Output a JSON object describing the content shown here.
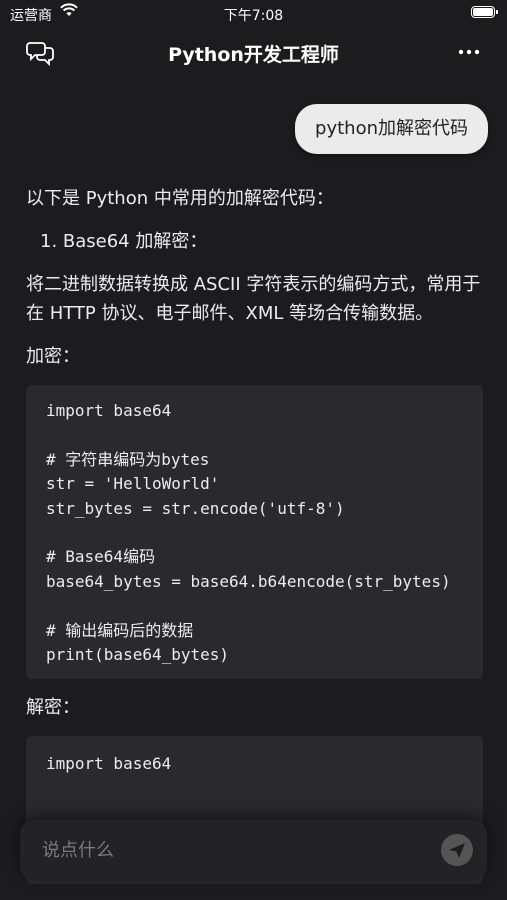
{
  "status_bar": {
    "carrier": "运营商",
    "time": "下午7:08"
  },
  "nav": {
    "title": "Python开发工程师"
  },
  "user_message": "python加解密代码",
  "answer": {
    "intro": "以下是 Python 中常用的加解密代码：",
    "item1": "1.  Base64 加解密：",
    "desc": "将二进制数据转换成 ASCII 字符表示的编码方式，常用于在 HTTP 协议、电子邮件、XML 等场合传输数据。",
    "encrypt_label": "加密：",
    "encrypt_code": "import base64\n\n# 字符串编码为bytes\nstr = 'HelloWorld'\nstr_bytes = str.encode('utf-8')\n\n# Base64编码\nbase64_bytes = base64.b64encode(str_bytes)\n\n# 输出编码后的数据\nprint(base64_bytes)",
    "decrypt_label": "解密：",
    "decrypt_code": "import base64"
  },
  "input": {
    "placeholder": "说点什么"
  },
  "icons": {
    "chat": "chat-bubbles-icon",
    "more": "more-dots-icon",
    "send": "send-icon",
    "wifi": "wifi-icon",
    "battery": "battery-icon"
  }
}
